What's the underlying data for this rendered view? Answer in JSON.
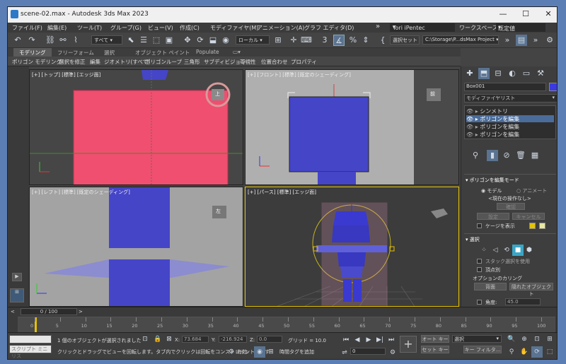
{
  "window": {
    "title": "scene-02.max - Autodesk 3ds Max 2023",
    "minimize": "—",
    "maximize": "☐",
    "close": "✕"
  },
  "menu": [
    "ファイル(F)",
    "編集(E)",
    "ツール(T)",
    "グループ(G)",
    "ビュー(V)",
    "作成(C)",
    "モディファイヤ(M)",
    "アニメーション(A)",
    "グラフ エディタ(D)"
  ],
  "menu_more": "»",
  "user": {
    "name": "Tori iPentec",
    "workspace_label": "ワークスペース:",
    "workspace_value": "既定値"
  },
  "toolbar": {
    "filter": "すべて",
    "coord": "ローカル",
    "selset": "選択セット",
    "project": "C:\\Storage\\P...dsMax Project"
  },
  "ribbon_tabs": [
    "モデリング",
    "フリーフォーム",
    "選択",
    "オブジェクト ペイント",
    "Populate"
  ],
  "ribbon_items": [
    "ポリゴン モデリング",
    "選択を修正",
    "編集",
    "ジオメトリ(すべて)",
    "ポリゴン",
    "ループ",
    "三角形",
    "サブディビジョン",
    "可視性",
    "位置合わせ",
    "プロパティ"
  ],
  "viewports": {
    "top": {
      "label": "[+] [トップ] [標準] [エッジ面]",
      "cube": "上"
    },
    "front": {
      "label": "[+] [フロント] [標準] [既定のシェーディング]",
      "cube": "前"
    },
    "left": {
      "label": "[+] [レフト] [標準] [既定のシェーディング]",
      "cube": "左"
    },
    "persp": {
      "label": "[+] [パース] [標準] [エッジ面]"
    }
  },
  "command_panel": {
    "object_name": "Box001",
    "object_color": "#3a3ae0",
    "modifier_list": "モディファイヤリスト",
    "stack": [
      "シンメトリ",
      "ポリゴンを編集",
      "ポリゴンを編集",
      "ポリゴンを編集"
    ],
    "rollout_mode_title": "ポリゴンを編集モード",
    "mode_model": "モデル",
    "mode_anim": "アニメート",
    "no_op": "<現在の操作なし>",
    "commit": "確認",
    "settings": "設定",
    "cancel": "キャンセル",
    "show_cage": "ケージを表示",
    "cage_color1": "#e5c400",
    "cage_color2": "#e8e8a0",
    "rollout_select_title": "選択",
    "stack_select": "スタック選択を使用",
    "by_vertex": "頂点別",
    "cull_title": "オプションのカリング",
    "backface": "背面",
    "occluded": "隠れたオブジェクト",
    "angle_label": "角度:",
    "angle_value": "45.0"
  },
  "timeline": {
    "frame": "0 / 100",
    "ticks": [
      "0",
      "5",
      "10",
      "15",
      "20",
      "25",
      "30",
      "35",
      "40",
      "45",
      "50",
      "55",
      "60",
      "65",
      "70",
      "75",
      "80",
      "85",
      "90",
      "95",
      "100"
    ]
  },
  "status": {
    "script_label": "スクリプト ミニ リス",
    "selected": "1 個のオブジェクトが選択されました",
    "hint": "クリックとドラッグでビューを回転します。タブ内でクリックは回転をコンストレイントします",
    "x_label": "X:",
    "x": "73.684",
    "y_label": "Y:",
    "y": "-216.924",
    "z_label": "Z:",
    "z": "0.0",
    "grid": "グリッド = 10.0",
    "enabled": "有効:",
    "add_tag": "時間タグを追加",
    "auto_key": "オート キー",
    "set_key": "セット キー",
    "selection": "選択",
    "key_filter": "キー フィルタ...",
    "frame_field": "0"
  },
  "colors": {
    "accent": "#2b79c7",
    "top_plane": "#f04f6f",
    "mesh_blue": "#4545c8",
    "selection_yellow": "#e6c100"
  }
}
